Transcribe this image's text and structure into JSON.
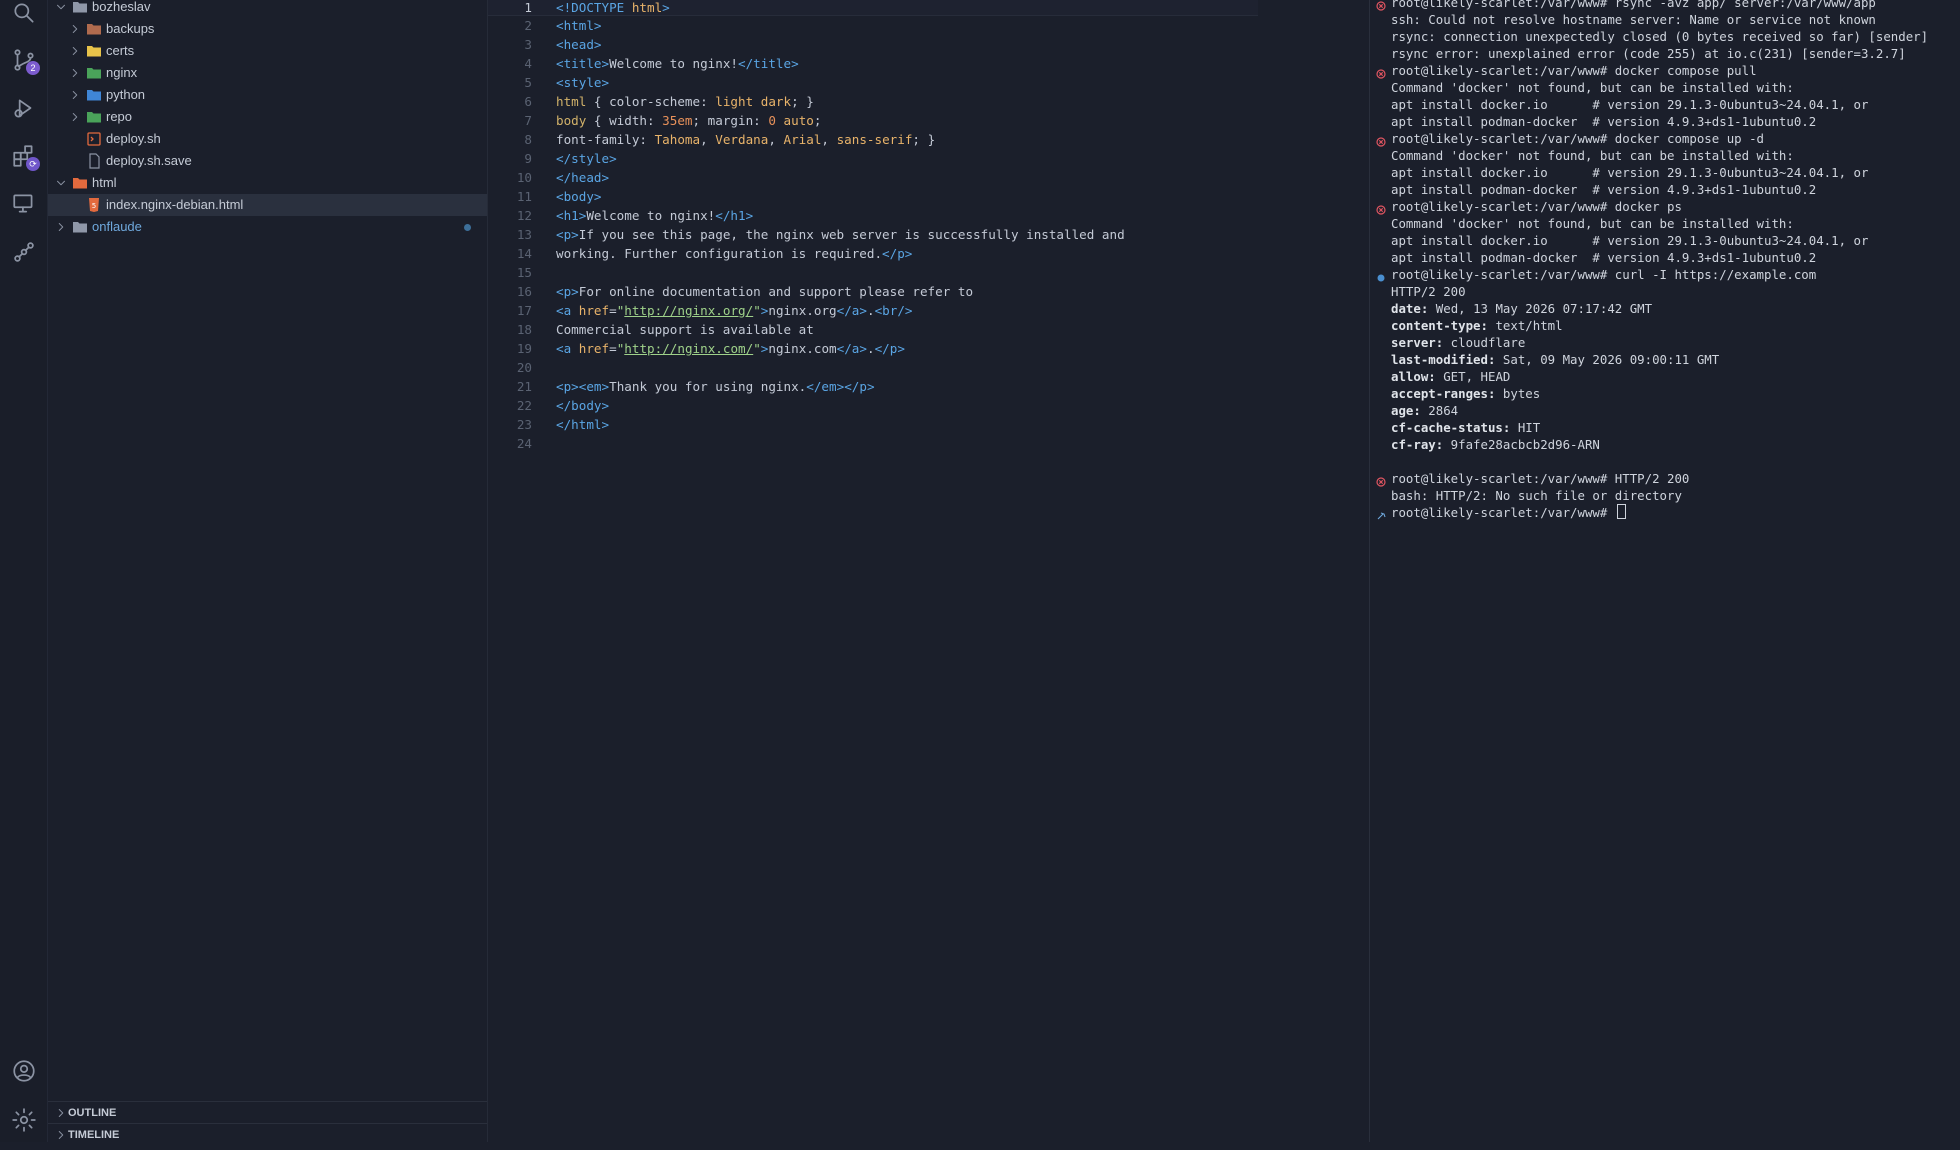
{
  "activity_bar": {
    "scm_badge": "2",
    "icons": [
      "search-icon",
      "source-control-icon",
      "run-debug-icon",
      "extensions-icon",
      "remote-explorer-icon",
      "git-graph-icon",
      "account-icon",
      "gear-icon"
    ]
  },
  "explorer": {
    "items": [
      {
        "label": "bozheslav",
        "type": "folder",
        "expanded": true
      },
      {
        "label": "backups",
        "type": "folder"
      },
      {
        "label": "certs",
        "type": "folder"
      },
      {
        "label": "nginx",
        "type": "folder"
      },
      {
        "label": "python",
        "type": "folder"
      },
      {
        "label": "repo",
        "type": "folder"
      },
      {
        "label": "deploy.sh",
        "type": "file"
      },
      {
        "label": "deploy.sh.save",
        "type": "file"
      },
      {
        "label": "html",
        "type": "folder",
        "expanded": true
      },
      {
        "label": "index.nginx-debian.html",
        "type": "file",
        "selected": true
      },
      {
        "label": "onflaude",
        "type": "folder",
        "modified": true
      }
    ],
    "outline_label": "OUTLINE",
    "timeline_label": "TIMELINE"
  },
  "editor": {
    "current_line": 1,
    "lines": [
      {
        "n": "1",
        "t": "<!DOCTYPE html>"
      },
      {
        "n": "2",
        "t": "<html>"
      },
      {
        "n": "3",
        "t": "<head>"
      },
      {
        "n": "4",
        "t": "<title>Welcome to nginx!</title>"
      },
      {
        "n": "5",
        "t": "<style>"
      },
      {
        "n": "6",
        "t": "html { color-scheme: light dark; }"
      },
      {
        "n": "7",
        "t": "body { width: 35em; margin: 0 auto;"
      },
      {
        "n": "8",
        "t": "font-family: Tahoma, Verdana, Arial, sans-serif; }"
      },
      {
        "n": "9",
        "t": "</style>"
      },
      {
        "n": "10",
        "t": "</head>"
      },
      {
        "n": "11",
        "t": "<body>"
      },
      {
        "n": "12",
        "t": "<h1>Welcome to nginx!</h1>"
      },
      {
        "n": "13",
        "t": "<p>If you see this page, the nginx web server is successfully installed and"
      },
      {
        "n": "14",
        "t": "working. Further configuration is required.</p>"
      },
      {
        "n": "15",
        "t": ""
      },
      {
        "n": "16",
        "t": "<p>For online documentation and support please refer to"
      },
      {
        "n": "17",
        "t": "<a href=\"http://nginx.org/\">nginx.org</a>.<br/>"
      },
      {
        "n": "18",
        "t": "Commercial support is available at"
      },
      {
        "n": "19",
        "t": "<a href=\"http://nginx.com/\">nginx.com</a>.</p>"
      },
      {
        "n": "20",
        "t": ""
      },
      {
        "n": "21",
        "t": "<p><em>Thank you for using nginx.</em></p>"
      },
      {
        "n": "22",
        "t": "</body>"
      },
      {
        "n": "23",
        "t": "</html>"
      },
      {
        "n": "24",
        "t": ""
      }
    ]
  },
  "terminal": {
    "lines": [
      {
        "t": "root@likely-scarlet:/var/www# rsync -avz app/ server:/var/www/app",
        "mark": "error"
      },
      {
        "t": "ssh: Could not resolve hostname server: Name or service not known"
      },
      {
        "t": "rsync: connection unexpectedly closed (0 bytes received so far) [sender]"
      },
      {
        "t": "rsync error: unexplained error (code 255) at io.c(231) [sender=3.2.7]"
      },
      {
        "t": "root@likely-scarlet:/var/www# docker compose pull",
        "mark": "error"
      },
      {
        "t": "Command 'docker' not found, but can be installed with:"
      },
      {
        "t": "apt install docker.io      # version 29.1.3-0ubuntu3~24.04.1, or"
      },
      {
        "t": "apt install podman-docker  # version 4.9.3+ds1-1ubuntu0.2"
      },
      {
        "t": "root@likely-scarlet:/var/www# docker compose up -d",
        "mark": "error"
      },
      {
        "t": "Command 'docker' not found, but can be installed with:"
      },
      {
        "t": "apt install docker.io      # version 29.1.3-0ubuntu3~24.04.1, or"
      },
      {
        "t": "apt install podman-docker  # version 4.9.3+ds1-1ubuntu0.2"
      },
      {
        "t": "root@likely-scarlet:/var/www# docker ps",
        "mark": "error"
      },
      {
        "t": "Command 'docker' not found, but can be installed with:"
      },
      {
        "t": "apt install docker.io      # version 29.1.3-0ubuntu3~24.04.1, or"
      },
      {
        "t": "apt install podman-docker  # version 4.9.3+ds1-1ubuntu0.2"
      },
      {
        "t": "root@likely-scarlet:/var/www# curl -I https://example.com",
        "mark": "success"
      },
      {
        "t": "HTTP/2 200"
      },
      {
        "k": "date:",
        "v": " Wed, 13 May 2026 07:17:42 GMT"
      },
      {
        "k": "content-type:",
        "v": " text/html"
      },
      {
        "k": "server:",
        "v": " cloudflare"
      },
      {
        "k": "last-modified:",
        "v": " Sat, 09 May 2026 09:00:11 GMT"
      },
      {
        "k": "allow:",
        "v": " GET, HEAD"
      },
      {
        "k": "accept-ranges:",
        "v": " bytes"
      },
      {
        "k": "age:",
        "v": " 2864"
      },
      {
        "k": "cf-cache-status:",
        "v": " HIT"
      },
      {
        "k": "cf-ray:",
        "v": " 9fafe28acbcb2d96-ARN"
      },
      {
        "t": ""
      },
      {
        "t": "root@likely-scarlet:/var/www# HTTP/2 200",
        "mark": "error"
      },
      {
        "t": "bash: HTTP/2: No such file or directory"
      },
      {
        "t": "root@likely-scarlet:/var/www# ",
        "mark": "prompt",
        "cursor": true
      }
    ]
  }
}
